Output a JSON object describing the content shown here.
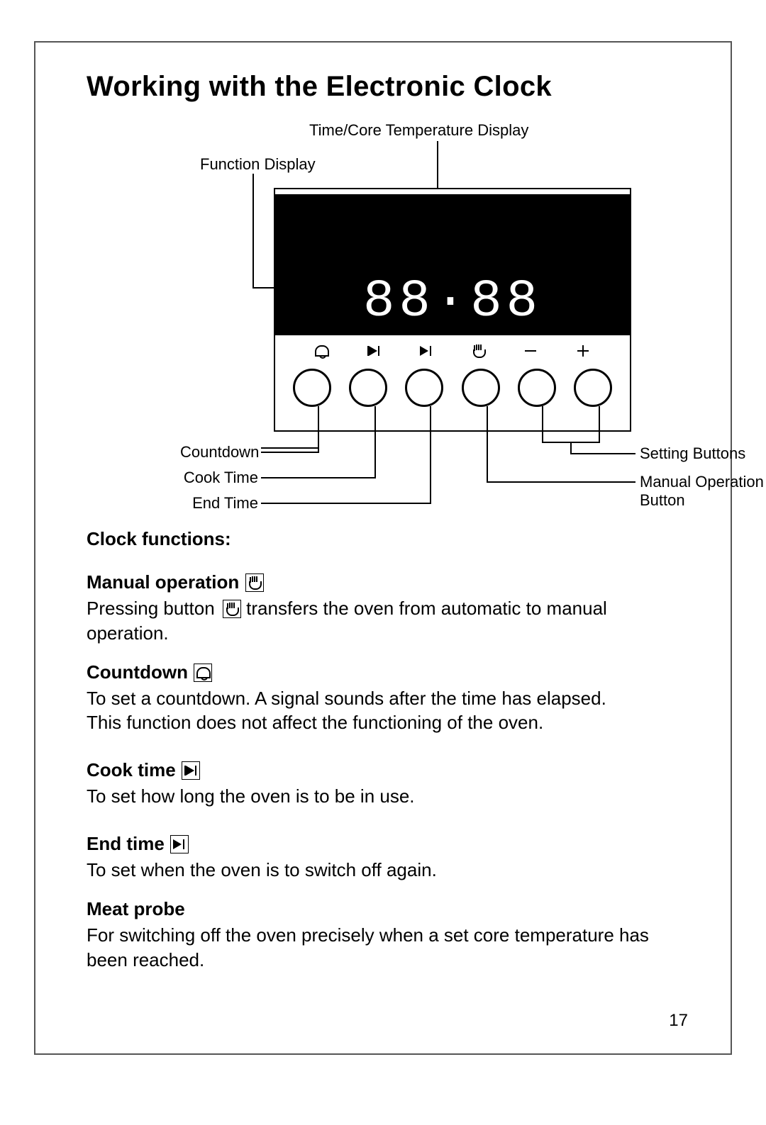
{
  "title": "Working with the Electronic Clock",
  "page_number": "17",
  "diagram": {
    "labels": {
      "time_core_temp": "Time/Core Temperature Display",
      "function_display": "Function Display",
      "countdown": "Countdown",
      "cook_time": "Cook Time",
      "end_time": "End Time",
      "setting_buttons": "Setting Buttons",
      "manual_op_button_l1": "Manual Operation",
      "manual_op_button_l2": "Button"
    },
    "display_digits": "88·88",
    "icons": [
      "bell",
      "cooktime",
      "endtime",
      "hand",
      "minus",
      "plus"
    ]
  },
  "clock_functions": {
    "heading": "Clock functions:",
    "items": [
      {
        "title": "Manual operation",
        "icon": "hand",
        "body": "Pressing button     transfers the oven from automatic to manual operation.",
        "inline_icon_after_word": 2
      },
      {
        "title": "Countdown",
        "icon": "bell",
        "body": "To set a countdown. A signal sounds after the time has elapsed.\nThis function does not affect the functioning of the oven."
      },
      {
        "title": "Cook time",
        "icon": "cooktime",
        "body": "To set how long the oven is to be in use."
      },
      {
        "title": "End time",
        "icon": "endtime",
        "body": "To set when the oven is to switch off again."
      },
      {
        "title": "Meat probe",
        "icon": null,
        "body": "For switching off the oven precisely when a set core temperature has been reached."
      }
    ]
  }
}
